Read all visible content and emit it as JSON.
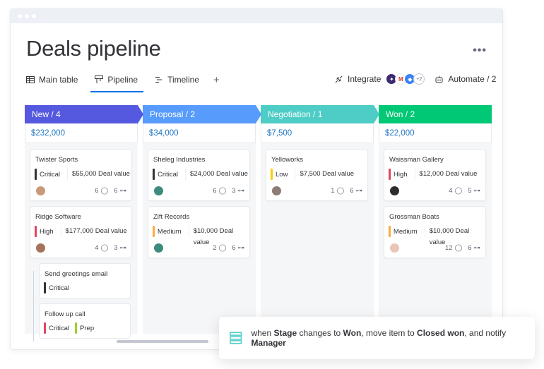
{
  "page": {
    "title": "Deals pipeline"
  },
  "tabs": [
    {
      "label": "Main table",
      "icon": "table-icon"
    },
    {
      "label": "Pipeline",
      "icon": "kanban-icon",
      "active": true
    },
    {
      "label": "Timeline",
      "icon": "timeline-icon"
    }
  ],
  "actions": {
    "integrate": "Integrate",
    "automate": "Automate / 2",
    "more_apps": "+2"
  },
  "columns": [
    {
      "label": "New / 4",
      "total": "$232,000",
      "color": "#5559df"
    },
    {
      "label": "Proposal / 2",
      "total": "$34,000",
      "color": "#579bfc"
    },
    {
      "label": "Negotiation / 1",
      "total": "$7,500",
      "color": "#4eccc6"
    },
    {
      "label": "Won / 2",
      "total": "$22,000",
      "color": "#00c875"
    }
  ],
  "cards": [
    {
      "title": "Twister Sports",
      "priority": "Critical",
      "value": "$55,000 Deal value",
      "updates": "6",
      "subitems": "6",
      "priority_color": "#333333"
    },
    {
      "title": "Ridge Software",
      "priority": "High",
      "value": "$177,000 Deal value",
      "updates": "4",
      "subitems": "3",
      "priority_color": "#e2445c"
    },
    {
      "title": "Sheleg Industries",
      "priority": "Critical",
      "value": "$24,000 Deal value",
      "updates": "6",
      "subitems": "3",
      "priority_color": "#333333"
    },
    {
      "title": "Zift Records",
      "priority": "Medium",
      "value": "$10,000 Deal value",
      "updates": "2",
      "subitems": "6",
      "priority_color": "#fdab3d"
    },
    {
      "title": "Yelloworks",
      "priority": "Low",
      "value": "$7,500 Deal value",
      "updates": "1",
      "subitems": "6",
      "priority_color": "#ffcb00"
    },
    {
      "title": "Waissman Gallery",
      "priority": "High",
      "value": "$12,000 Deal value",
      "updates": "4",
      "subitems": "5",
      "priority_color": "#e2445c"
    },
    {
      "title": "Grossman Boats",
      "priority": "Medium",
      "value": "$10,000 Deal value",
      "updates": "12",
      "subitems": "6",
      "priority_color": "#fdab3d"
    }
  ],
  "subitems": [
    {
      "title": "Send greetings email",
      "tag": "Critical",
      "tag_color": "#333333"
    },
    {
      "title": "Follow up call",
      "tag": "Critical",
      "tag_color": "#e2445c",
      "tag2": "Prep",
      "tag2_color": "#9cd326"
    }
  ],
  "automation": {
    "p1": "when ",
    "b1": "Stage",
    "p2": " changes to ",
    "b2": "Won",
    "p3": ", move item to ",
    "b3": "Closed won",
    "p4": ", and notify ",
    "b4": "Manager"
  }
}
